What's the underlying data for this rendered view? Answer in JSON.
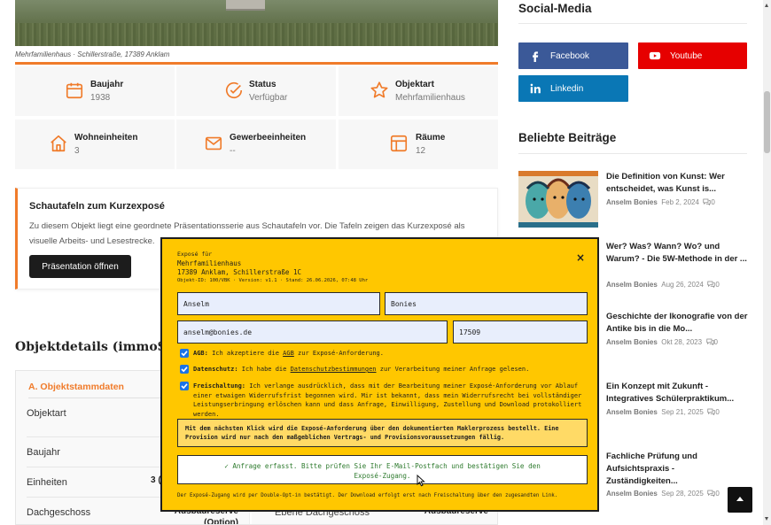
{
  "image": {
    "caption": "Mehrfamilienhaus · Schillerstraße, 17389 Anklam"
  },
  "facts": [
    {
      "label": "Baujahr",
      "value": "1938",
      "icon": "calendar-icon"
    },
    {
      "label": "Status",
      "value": "Verfügbar",
      "icon": "check-circle-icon"
    },
    {
      "label": "Objektart",
      "value": "Mehrfamilienhaus",
      "icon": "star-icon"
    },
    {
      "label": "Wohneinheiten",
      "value": "3",
      "icon": "house-icon"
    },
    {
      "label": "Gewerbeeinheiten",
      "value": "--",
      "icon": "mail-icon"
    },
    {
      "label": "Räume",
      "value": "12",
      "icon": "layout-icon"
    }
  ],
  "showcase": {
    "title": "Schautafeln zum Kurzexposé",
    "text": "Zu diesem Objekt liegt eine geordnete Präsentationsserie aus Schautafeln vor. Die Tafeln zeigen das Kurzexposé als visuelle Arbeits- und Lesestrecke.",
    "button": "Präsentation öffnen"
  },
  "details": {
    "title": "Objektdetails (immoS",
    "section": "A. Objektstammdaten",
    "rows": [
      "Objektart",
      "Baujahr",
      "Einheiten",
      "Dachgeschoss"
    ],
    "value_units": "3 (",
    "value_dach1": "Ausbaureserve",
    "value_dach2": "(Option)",
    "right_label": "Ebene Dachgeschoss",
    "right_value": "Ausbaureserve"
  },
  "sidebar": {
    "social_title": "Social-Media",
    "social": [
      {
        "label": "Facebook",
        "color": "#3b5998",
        "icon": "facebook-icon"
      },
      {
        "label": "Youtube",
        "color": "#e60000",
        "icon": "youtube-icon"
      },
      {
        "label": "Linkedin",
        "color": "#0a77b5",
        "icon": "linkedin-icon"
      }
    ],
    "popular_title": "Beliebte Beiträge",
    "posts": [
      {
        "title": "Die Definition von Kunst: Wer entscheidet, was Kunst is...",
        "author": "Anselm Bonies",
        "date": "Feb 2, 2024",
        "comments": "0"
      },
      {
        "title": "Wer? Was? Wann? Wo? und Warum? - Die 5W-Methode in der ...",
        "author": "Anselm Bonies",
        "date": "Aug 26, 2024",
        "comments": "0"
      },
      {
        "title": "Geschichte der Ikonografie von der Antike bis in die Mo...",
        "author": "Anselm Bonies",
        "date": "Okt 28, 2023",
        "comments": "0"
      },
      {
        "title": "Ein Konzept mit Zukunft - Integratives Schülerpraktikum...",
        "author": "Anselm Bonies",
        "date": "Sep 21, 2025",
        "comments": "0"
      },
      {
        "title": "Fachliche Prüfung und Aufsichtspraxis - Zuständigkeiten...",
        "author": "Anselm Bonies",
        "date": "Sep 28, 2025",
        "comments": "0"
      }
    ]
  },
  "modal": {
    "kicker": "Exposé für",
    "title_line1": "Mehrfamilienhaus",
    "title_line2": "17389 Anklam, Schillerstraße 1C",
    "meta": "Objekt-ID: 100/VBK · Version: v1.1 · Stand: 26.06.2026, 07:48 Uhr",
    "close": "×",
    "first_name": "Anselm",
    "last_name": "Bonies",
    "email": "anselm@bonies.de",
    "zip": "17509",
    "check1_bold": "AGB:",
    "check1_pre": " Ich akzeptiere die ",
    "check1_link": "AGB",
    "check1_post": " zur Exposé-Anforderung.",
    "check2_bold": "Datenschutz:",
    "check2_pre": " Ich habe die ",
    "check2_link": "Datenschutzbestimmungen",
    "check2_post": " zur Verarbeitung meiner Anfrage gelesen.",
    "check3_bold": "Freischaltung:",
    "check3_text": " Ich verlange ausdrücklich, dass mit der Bearbeitung meiner Exposé-Anforderung vor Ablauf einer etwaigen Widerrufsfrist begonnen wird. Mir ist bekannt, dass mein Widerrufsrecht bei vollständiger Leistungserbringung erlöschen kann und dass Anfrage, Einwilligung, Zustellung und Download protokolliert werden.",
    "notice": "Mit dem nächsten Klick wird die Exposé-Anforderung über den dokumentierten Maklerprozess bestellt. Eine Provision wird nur nach den maßgeblichen Vertrags- und Provisionsvoraussetzungen fällig.",
    "success": "✓ Anfrage erfasst. Bitte prüfen Sie Ihr E-Mail-Postfach und bestätigen Sie den Exposé-Zugang.",
    "footer": "Der Exposé-Zugang wird per Double-Opt-in bestätigt. Der Download erfolgt erst nach Freischaltung über den zugesandten Link."
  },
  "colors": {
    "accent": "#f07b2a",
    "modal_bg": "#ffc700",
    "success_text": "#2d7a2d"
  }
}
